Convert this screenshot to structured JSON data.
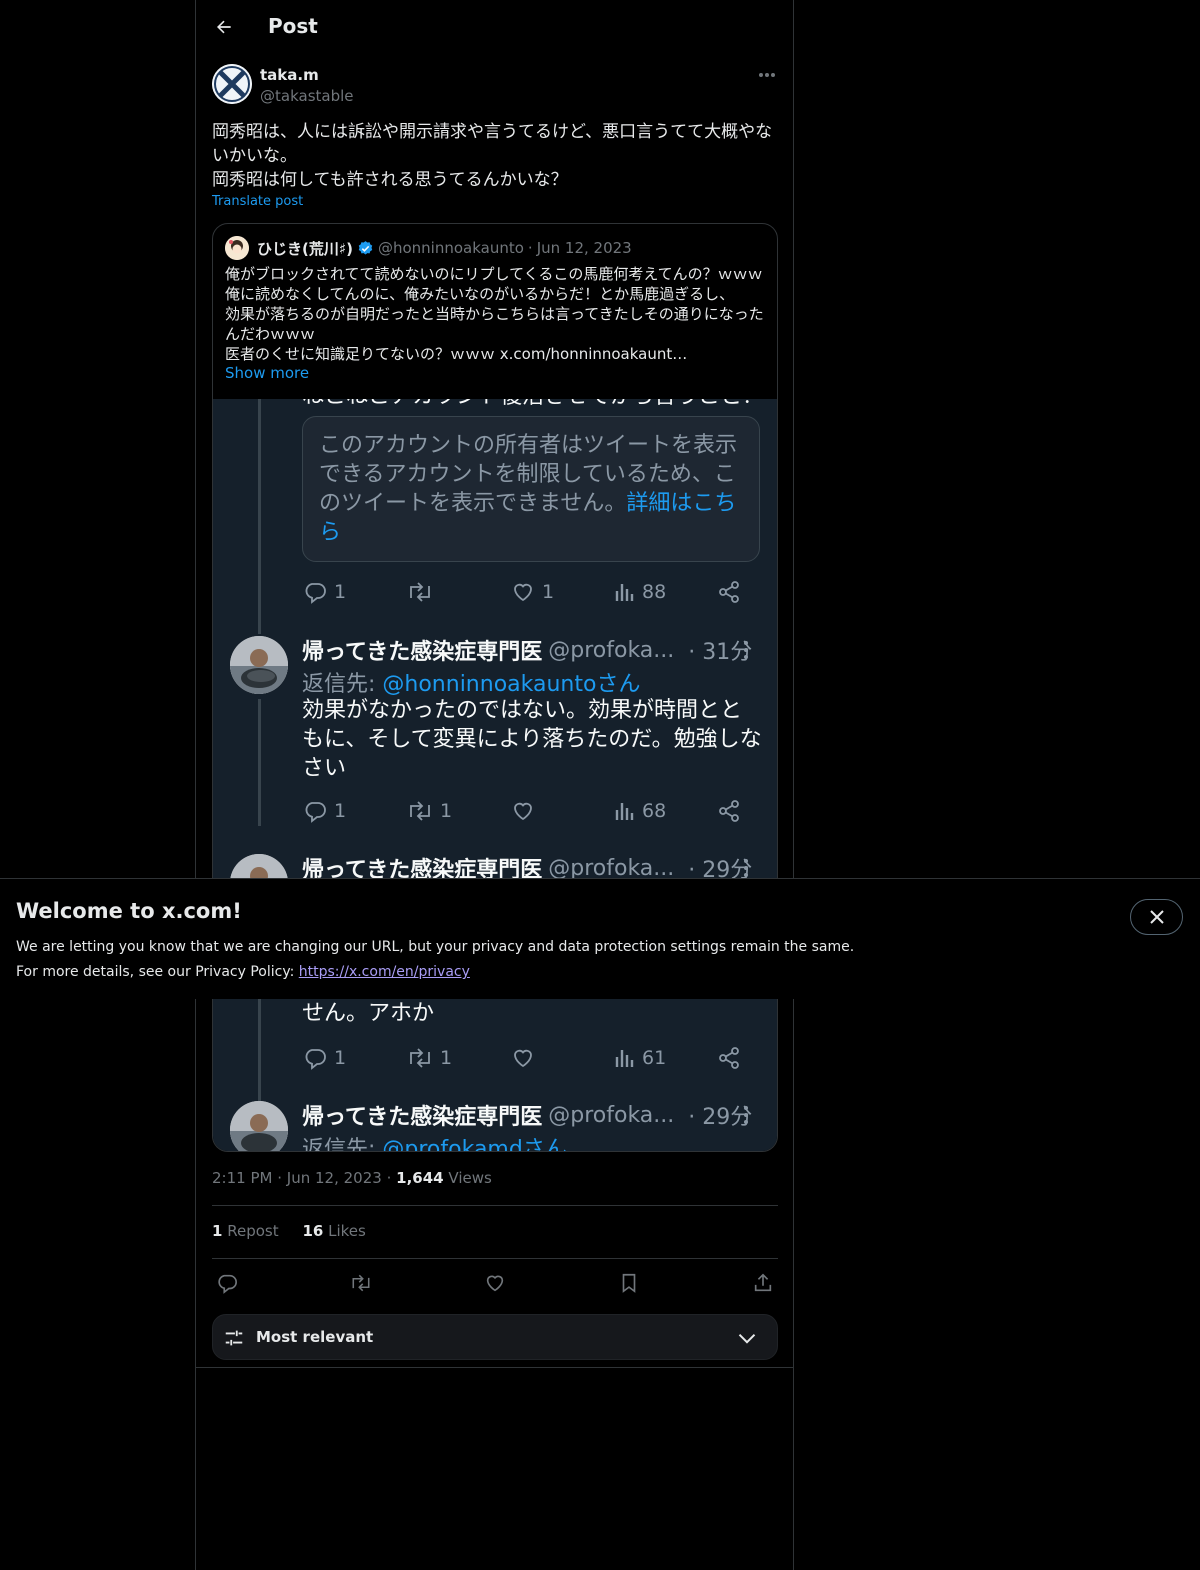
{
  "header": {
    "title": "Post"
  },
  "post": {
    "author_name": "taka.m",
    "author_handle": "@takastable",
    "text_lines": [
      "岡秀昭は、人には訴訟や開示請求や言うてるけど、悪口言うてて大概やないかいな。",
      "岡秀昭は何しても許される思うてるんかいな？"
    ],
    "translate_label": "Translate post",
    "time": "2:11 PM",
    "date": "Jun 12, 2023",
    "views_count": "1,644",
    "views_label": "Views",
    "reposts_count": "1",
    "reposts_label": "Repost",
    "likes_count": "16",
    "likes_label": "Likes",
    "separator": "·"
  },
  "quote": {
    "name": "ひじき(荒川♯)",
    "handle": "@honninnoakaunto",
    "separator": "·",
    "date": "Jun 12, 2023",
    "text_lines": [
      "俺がブロックされてて読めないのにリプしてくるこの馬鹿何考えてんの？ｗｗｗ",
      "俺に読めなくしてんのに、俺みたいなのがいるからだ！とか馬鹿過ぎるし、",
      "効果が落ちるのが自明だったと当時からこちらは言ってきたしその通りになったんだわｗｗｗ",
      "医者のくせに知識足りてないの？ｗｗｗ x.com/honninnoakaunt…"
    ],
    "show_more": "Show more"
  },
  "screenshot": {
    "cut_text_top": "ねこねこアカウント復活させてから言うこと？",
    "restricted_text": "このアカウントの所有者はツイートを表示できるアカウントを制限しているため、このツイートを表示できません。",
    "restricted_link": "詳細はこちら",
    "row1": {
      "reply": "1",
      "retweet": "",
      "like": "1",
      "views": "88"
    },
    "reply1": {
      "name": "帰ってきた感染症専門医",
      "handle": "@profoka...",
      "time": "· 31分",
      "reply_to_prefix": "返信先: ",
      "reply_to_handle": "@honninnoakauntoさん",
      "body": "効果がなかったのではない。効果が時間とともに、そして変異により落ちたのだ。勉強しなさい",
      "counts": {
        "reply": "1",
        "retweet": "1",
        "like": "",
        "views": "68"
      }
    },
    "reply2": {
      "name": "帰ってきた感染症専門医",
      "handle": "@profoka...",
      "time": "· 29分",
      "body_tail": "せん。アホか",
      "counts": {
        "reply": "1",
        "retweet": "1",
        "like": "",
        "views": "61"
      }
    },
    "reply3": {
      "name": "帰ってきた感染症専門医",
      "handle": "@profoka...",
      "time": "· 29分",
      "reply_to_prefix": "返信先: ",
      "reply_to_handle": "@profokamdさん、"
    }
  },
  "sort": {
    "label": "Most relevant"
  },
  "banner": {
    "title": "Welcome to x.com!",
    "line1": "We are letting you know that we are changing our URL, but your privacy and data protection settings remain the same.",
    "line2_prefix": "For more details, see our Privacy Policy: ",
    "link": "https://x.com/en/privacy"
  },
  "colors": {
    "background": "#000000",
    "accent": "#1d9bf0",
    "muted": "#71767b",
    "screenshot_bg": "#15202b",
    "verified": "#1d9bf0"
  }
}
